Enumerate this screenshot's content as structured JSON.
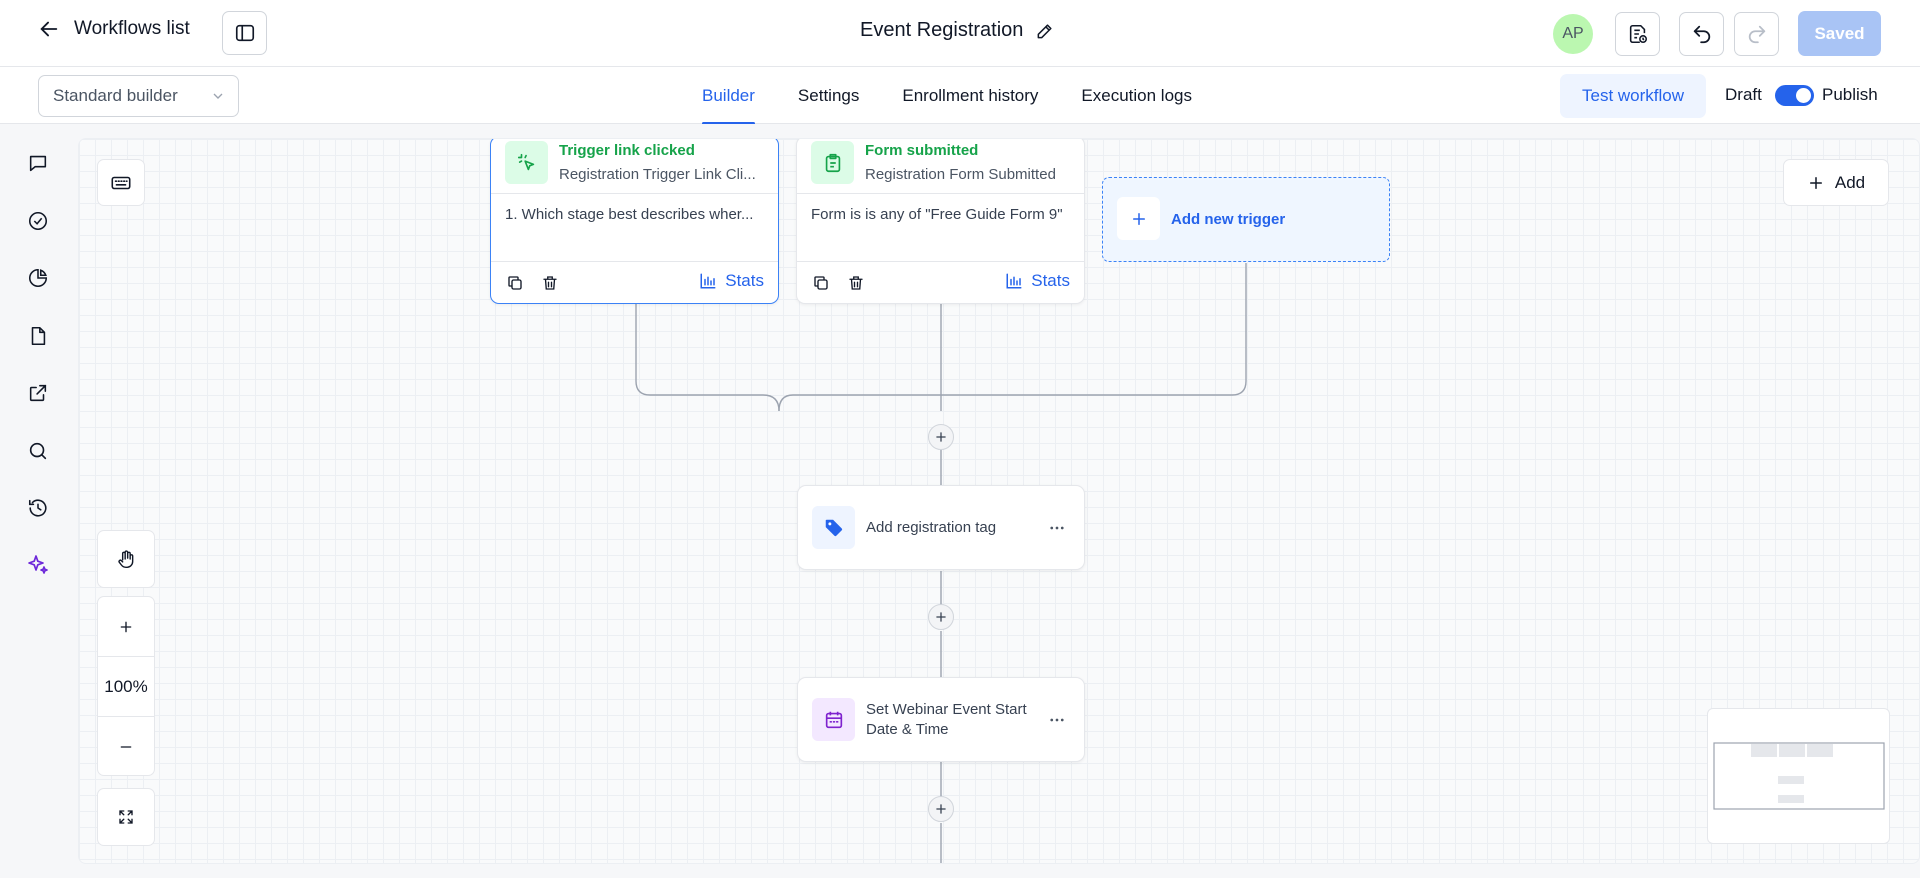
{
  "header": {
    "back_label": "Workflows list",
    "title": "Event Registration",
    "avatar_initials": "AP",
    "saved_label": "Saved"
  },
  "subbar": {
    "builder_mode": "Standard builder",
    "tabs": [
      {
        "label": "Builder",
        "active": true
      },
      {
        "label": "Settings",
        "active": false
      },
      {
        "label": "Enrollment history",
        "active": false
      },
      {
        "label": "Execution logs",
        "active": false
      }
    ],
    "test_label": "Test workflow",
    "draft_label": "Draft",
    "publish_label": "Publish"
  },
  "canvas": {
    "add_label": "Add",
    "zoom_level": "100%",
    "triggers": [
      {
        "title": "Trigger link clicked",
        "subtitle": "Registration Trigger Link Cli...",
        "condition": "1. Which stage best describes wher...",
        "stats_label": "Stats",
        "selected": true
      },
      {
        "title": "Form submitted",
        "subtitle": "Registration Form Submitted",
        "condition": "Form is is any of \"Free Guide Form 9\"",
        "stats_label": "Stats",
        "selected": false
      }
    ],
    "add_trigger_label": "Add new trigger",
    "actions": [
      {
        "label": "Add registration tag",
        "icon": "tag-icon"
      },
      {
        "label": "Set Webinar Event Start Date & Time",
        "icon": "calendar-icon"
      }
    ]
  },
  "colors": {
    "accent": "#2563eb",
    "trigger_green": "#16a34a",
    "saved_bg": "#a9c4f5",
    "avatar_bg": "#bbf7b0",
    "ai_purple": "#6d28d9"
  }
}
